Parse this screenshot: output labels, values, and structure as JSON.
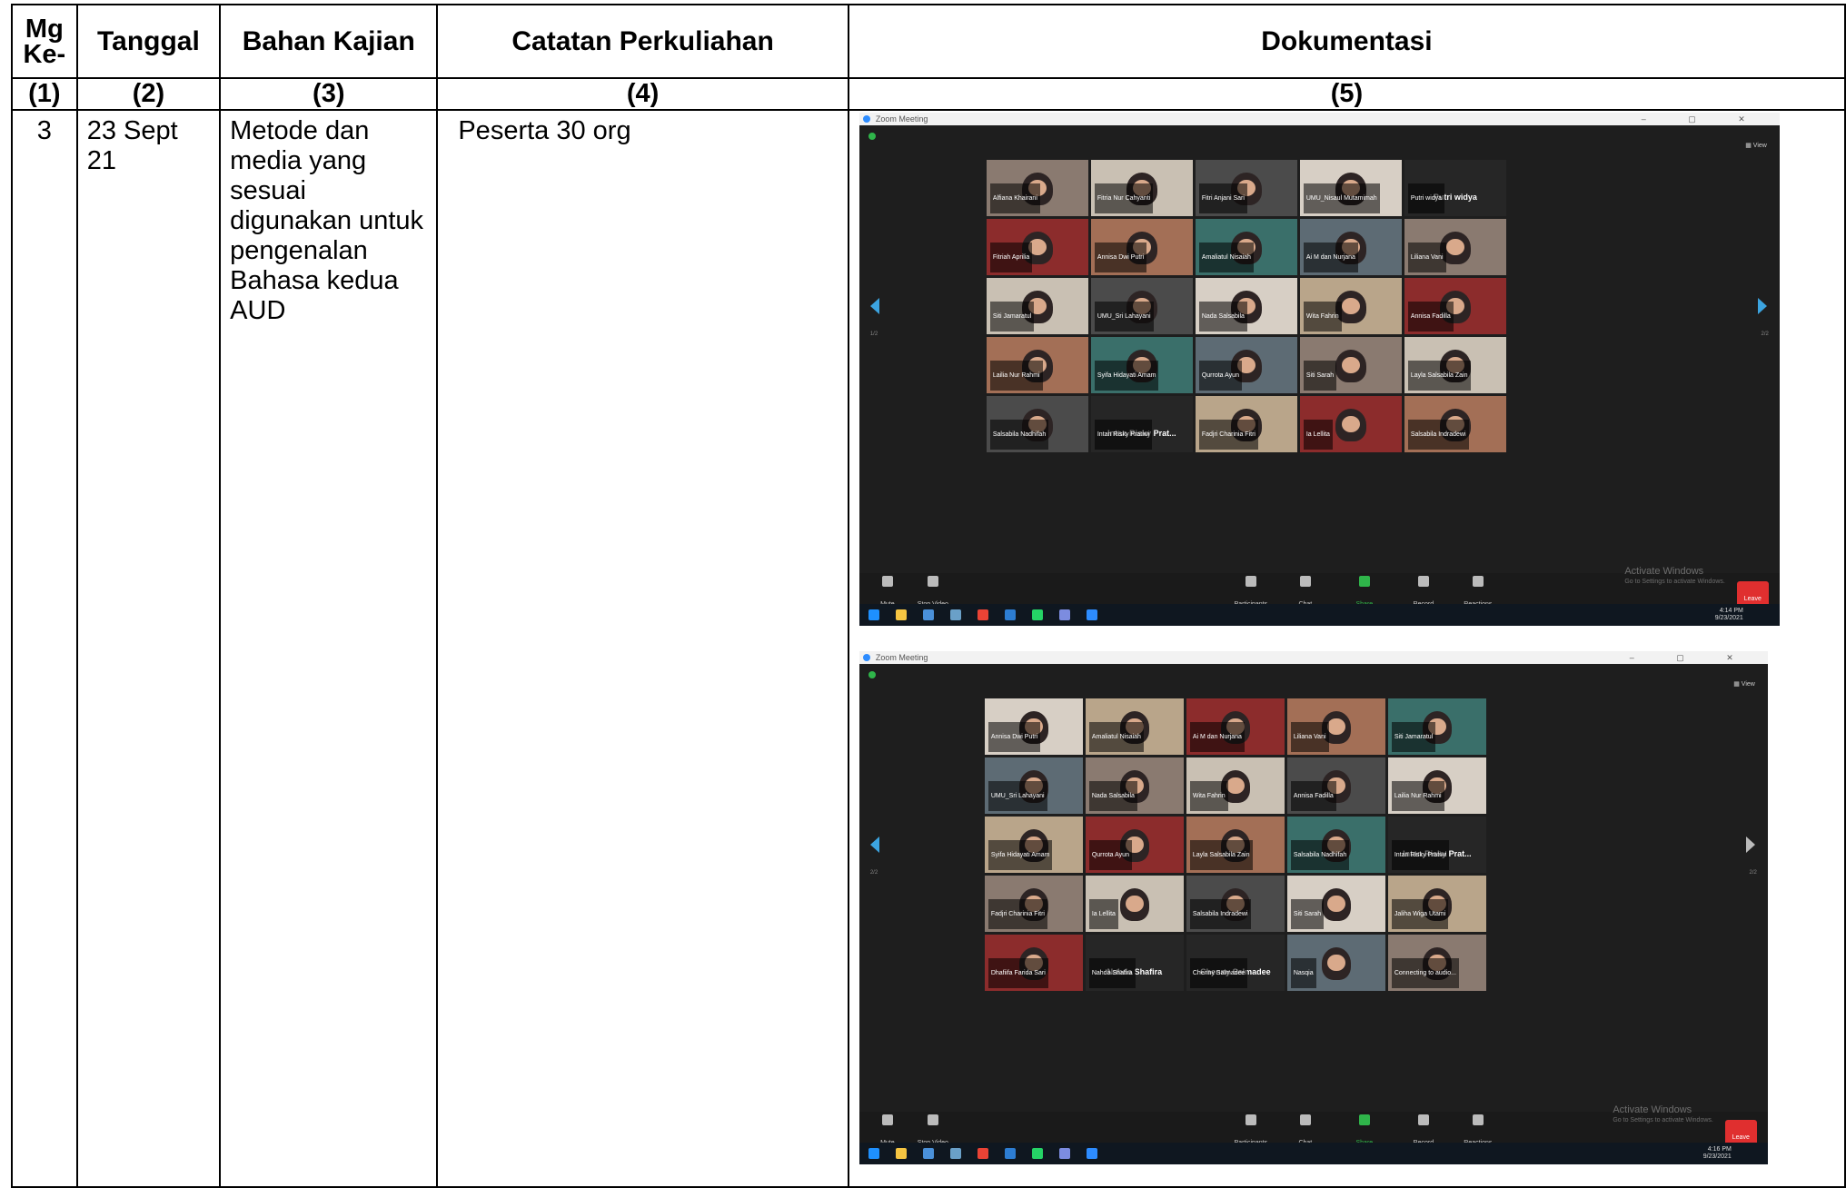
{
  "headers": {
    "col1": "Mg Ke-",
    "col2": "Tanggal",
    "col3": "Bahan Kajian",
    "col4": "Catatan Perkuliahan",
    "col5": "Dokumentasi"
  },
  "numbers": [
    "(1)",
    "(2)",
    "(3)",
    "(4)",
    "(5)"
  ],
  "row": {
    "mg": "3",
    "tanggal": "23 Sept 21",
    "bahan": "Metode dan media yang sesuai digunakan untuk pengenalan Bahasa kedua AUD",
    "catatan": "Peserta 30 org"
  },
  "screenshots": [
    {
      "window_title": "Zoom Meeting",
      "view_label": "View",
      "page_left": "1/2",
      "page_right": "2/2",
      "tiles": [
        "Alfiana Khairani",
        "Fitria Nur Cahyanti",
        "Fitri Anjani Sari",
        "UMU_Nisaul Mutamimah",
        "Putri widya",
        "Fitriah Aprilia",
        "Annisa Dwi Putri",
        "Amaliatul Nisaiah",
        "Ai M dan Nurjana",
        "Liliana Vani",
        "Siti Jamaratul",
        "UMU_Sri Lahayani",
        "Nada Salsabila",
        "Wita Fahrin",
        "Annisa Fadilla",
        "Lailia Nur Rahmi",
        "Syifa Hidayati Amam",
        "Qurrota Ayun",
        "Siti Sarah",
        "Layla Salsabila Zain",
        "Salsabila Nadhifah",
        "Intan Risky Pratiwi",
        "Fadjri Charinia Fitri",
        "Ia Lellita",
        "Salsabila Indradewi"
      ],
      "big_name_tiles": {
        "4": "Putri widya",
        "21": "Intan Risky Prat..."
      },
      "toolbar": [
        "Mute",
        "Stop Video",
        "Participants",
        "Chat",
        "Share Screen",
        "Record",
        "Reactions"
      ],
      "end_label": "Leave",
      "watermark_title": "Activate Windows",
      "watermark_sub": "Go to Settings to activate Windows.",
      "clock_time": "4:14 PM",
      "clock_date": "9/23/2021"
    },
    {
      "window_title": "Zoom Meeting",
      "view_label": "View",
      "page_left": "2/2",
      "page_right": "2/2",
      "tiles": [
        "Annisa Dwi Putri",
        "Amaliatul Nisaiah",
        "Ai M dan Nurjana",
        "Liliana Vani",
        "Siti Jamaratul",
        "UMU_Sri Lahayani",
        "Nada Salsabila",
        "Wita Fahrin",
        "Annisa Fadilla",
        "Lailia Nur Rahmi",
        "Syifa Hidayati Amam",
        "Qurrota Ayun",
        "Layla Salsabila Zain",
        "Salsabila Nadhifah",
        "Intan Risky Pratiwi",
        "Fadjri Charinia Fitri",
        "Ia Lellita",
        "Salsabila Indradewi",
        "Siti Sarah",
        "Jaliha Wiga Utami",
        "Dhafiifa Farida Sari",
        "Nahda Shafira",
        "Chenny Salmadee",
        "Nasqia",
        "Connecting to audio..."
      ],
      "big_name_tiles": {
        "14": "Intan Risky Prat...",
        "21": "Nahda Shafira",
        "22": "Chenny Salmadee"
      },
      "toolbar": [
        "Mute",
        "Stop Video",
        "Participants",
        "Chat",
        "Share Screen",
        "Record",
        "Reactions"
      ],
      "end_label": "Leave",
      "watermark_title": "Activate Windows",
      "watermark_sub": "Go to Settings to activate Windows.",
      "clock_time": "4:16 PM",
      "clock_date": "9/23/2021"
    }
  ]
}
